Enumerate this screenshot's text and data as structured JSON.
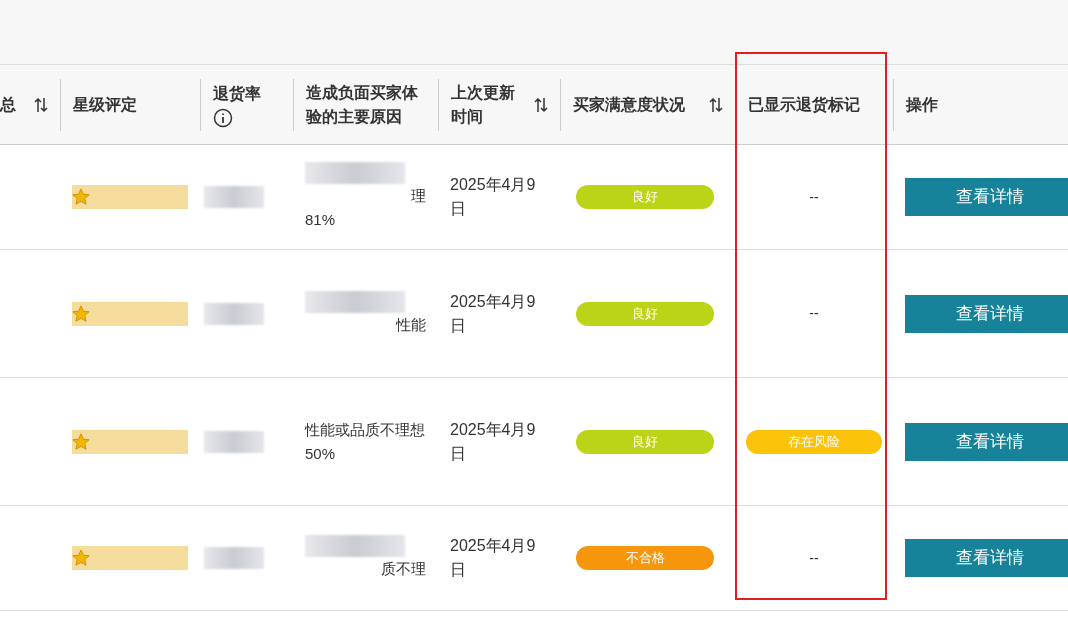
{
  "table": {
    "columns": [
      {
        "label": "总",
        "sortable": true
      },
      {
        "label": "星级评定",
        "sortable": false
      },
      {
        "label": "退货率",
        "sortable": false,
        "info": true
      },
      {
        "label": "造成负面买家体验的主要原因",
        "sortable": false
      },
      {
        "label": "上次更新时间",
        "sortable": true
      },
      {
        "label": "买家满意度状况",
        "sortable": true
      },
      {
        "label": "已显示退货标记",
        "sortable": false
      },
      {
        "label": "操作",
        "sortable": false
      }
    ],
    "rows": [
      {
        "reason": "理",
        "reason_redacted": true,
        "share": "81%",
        "updated": "2025年4月9日",
        "status": {
          "label": "良好",
          "kind": "good"
        },
        "return_flag": {
          "kind": "none",
          "label": "--"
        },
        "action": "查看详情"
      },
      {
        "reason": "性能",
        "reason_redacted": true,
        "updated": "2025年4月9日",
        "status": {
          "label": "良好",
          "kind": "good"
        },
        "return_flag": {
          "kind": "none",
          "label": "--"
        },
        "action": "查看详情"
      },
      {
        "reason": "性能或品质不理想",
        "reason_redacted": false,
        "share": "50%",
        "updated": "2025年4月9日",
        "status": {
          "label": "良好",
          "kind": "good"
        },
        "return_flag": {
          "kind": "risk",
          "label": "存在风险"
        },
        "action": "查看详情"
      },
      {
        "reason": "质不理",
        "reason_redacted": true,
        "updated": "2025年4月9日",
        "status": {
          "label": "不合格",
          "kind": "fail"
        },
        "return_flag": {
          "kind": "none",
          "label": "--"
        },
        "action": "查看详情"
      }
    ]
  }
}
